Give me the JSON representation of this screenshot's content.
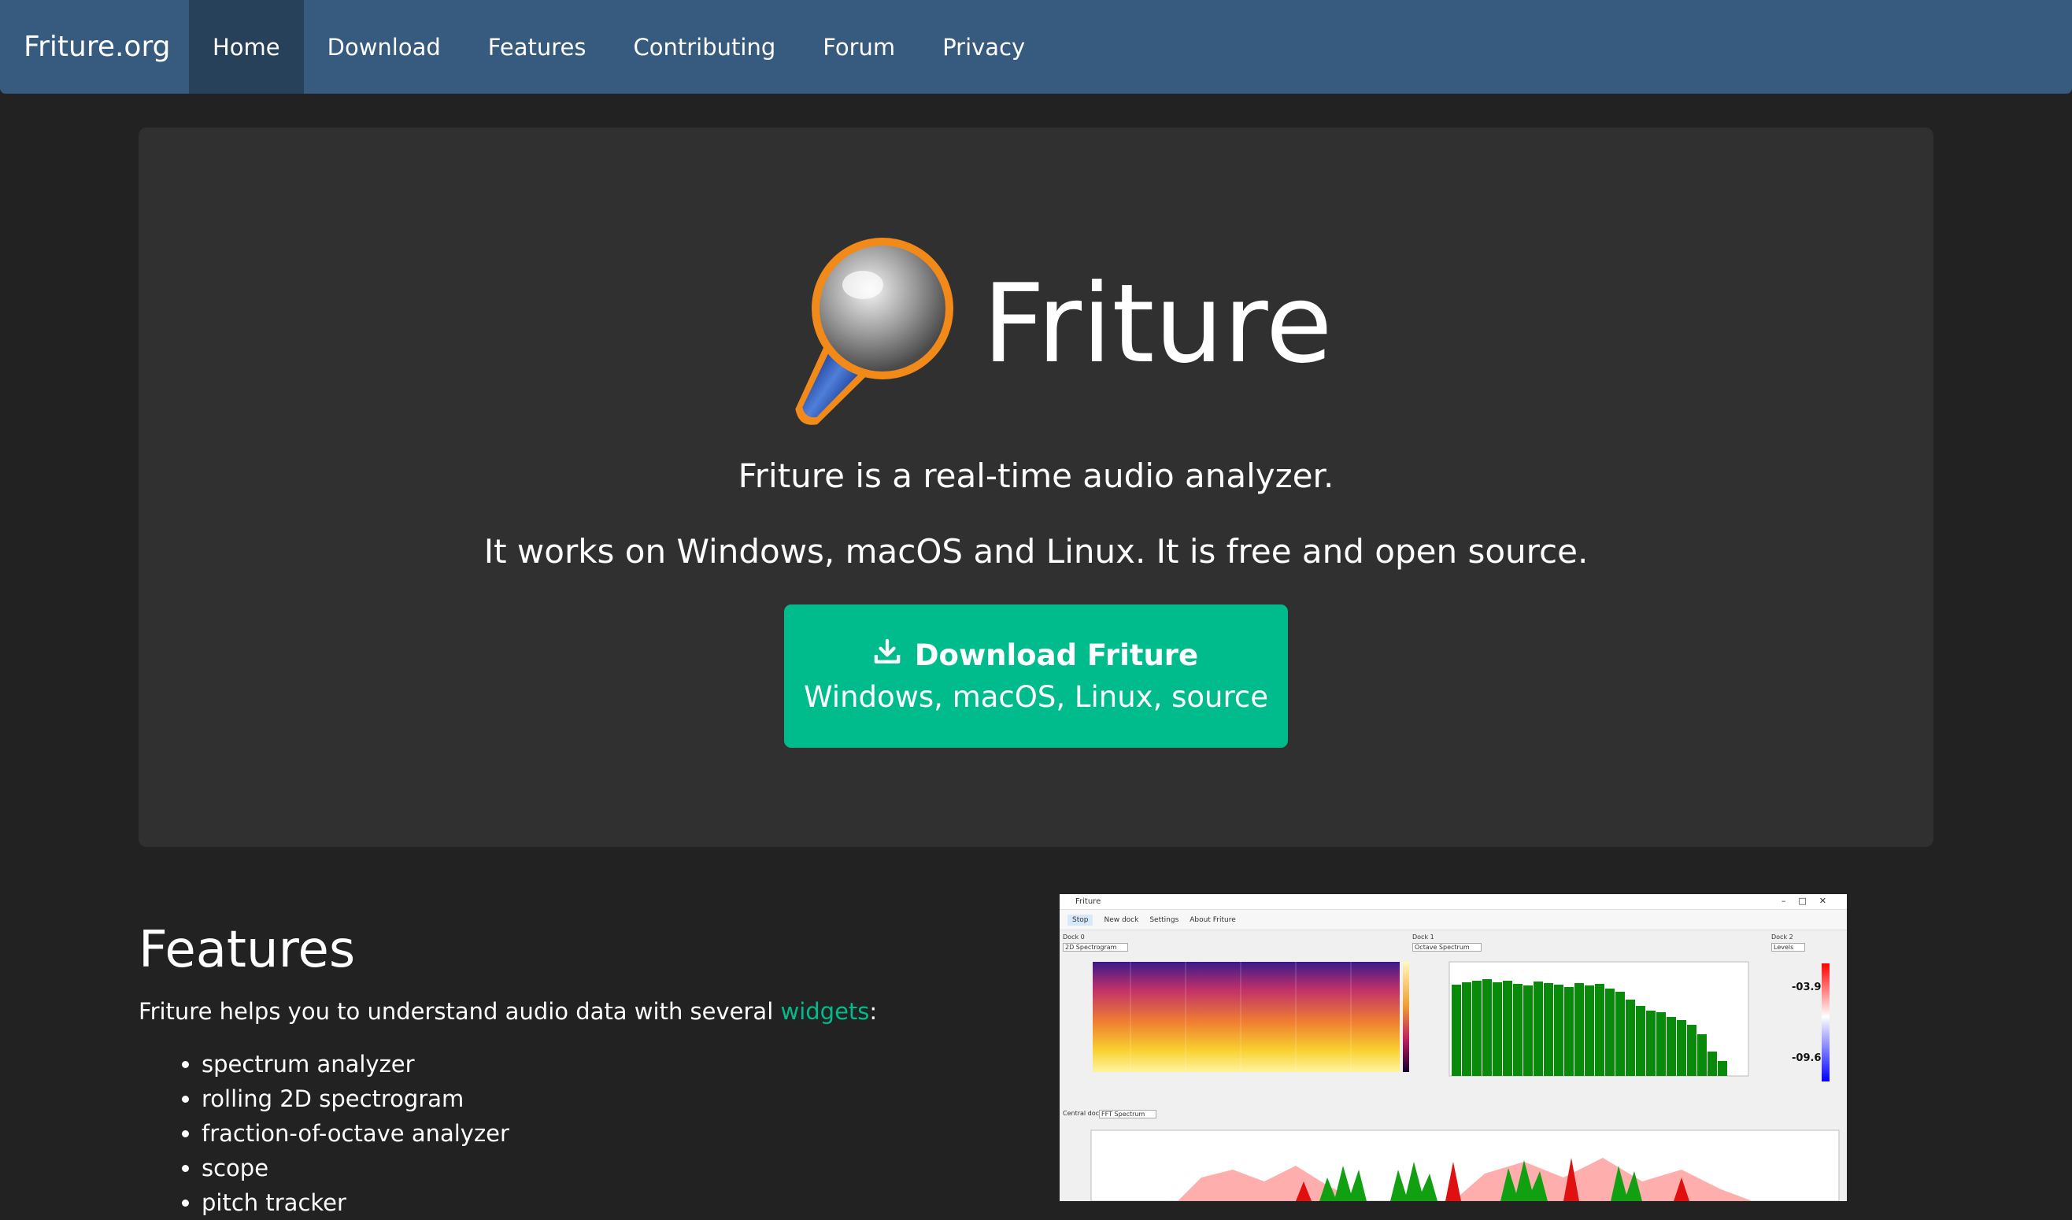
{
  "navbar": {
    "brand": "Friture.org",
    "items": [
      {
        "label": "Home",
        "active": true
      },
      {
        "label": "Download",
        "active": false
      },
      {
        "label": "Features",
        "active": false
      },
      {
        "label": "Contributing",
        "active": false
      },
      {
        "label": "Forum",
        "active": false
      },
      {
        "label": "Privacy",
        "active": false
      }
    ]
  },
  "hero": {
    "title": "Friture",
    "tagline1": "Friture is a real-time audio analyzer.",
    "tagline2": "It works on Windows, macOS and Linux. It is free and open source.",
    "download_label": "Download Friture",
    "download_sub": "Windows, macOS, Linux, source",
    "download_icon": "download-icon"
  },
  "features": {
    "title": "Features",
    "intro_before": "Friture helps you to understand audio data with several ",
    "intro_link": "widgets",
    "intro_after": ":",
    "items": [
      "spectrum analyzer",
      "rolling 2D spectrogram",
      "fraction-of-octave analyzer",
      "scope",
      "pitch tracker"
    ]
  },
  "screenshot": {
    "window_title": "Friture",
    "toolbar": [
      "Stop",
      "New dock",
      "Settings",
      "About Friture"
    ],
    "dock0": "Dock 0",
    "dock0_widget": "2D Spectrogram",
    "dock1": "Dock 1",
    "dock1_widget": "Octave Spectrum",
    "dock2": "Dock 2",
    "dock2_widget": "Levels",
    "central": "Central dock",
    "central_widget": "FFT Spectrum",
    "level_top": "-03.9",
    "level_bottom": "-09.6"
  },
  "colors": {
    "navbar": "#375a7f",
    "navbar_active": "#28415b",
    "background": "#222222",
    "jumbotron": "#303030",
    "accent": "#00bc8c"
  }
}
